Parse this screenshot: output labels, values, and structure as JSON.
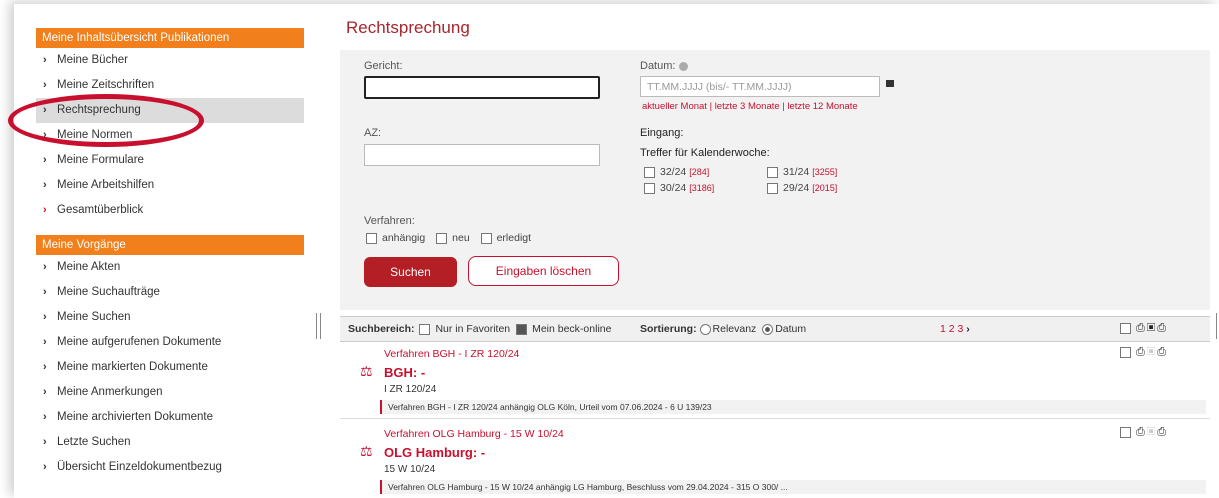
{
  "sidebar": {
    "section1_title": "Meine Inhaltsübersicht Publikationen",
    "section1_items": [
      {
        "label": "Meine Bücher"
      },
      {
        "label": "Meine Zeitschriften"
      },
      {
        "label": "Rechtsprechung"
      },
      {
        "label": "Meine Normen"
      },
      {
        "label": "Meine Formulare"
      },
      {
        "label": "Meine Arbeitshilfen"
      },
      {
        "label": "Gesamtüberblick"
      }
    ],
    "section2_title": "Meine Vorgänge",
    "section2_items": [
      {
        "label": "Meine Akten"
      },
      {
        "label": "Meine Suchaufträge"
      },
      {
        "label": "Meine Suchen"
      },
      {
        "label": "Meine aufgerufenen Dokumente"
      },
      {
        "label": "Meine markierten Dokumente"
      },
      {
        "label": "Meine Anmerkungen"
      },
      {
        "label": "Meine archivierten Dokumente"
      },
      {
        "label": "Letzte Suchen"
      },
      {
        "label": "Übersicht Einzeldokumentbezug"
      }
    ]
  },
  "page": {
    "title": "Rechtsprechung"
  },
  "form": {
    "gericht_label": "Gericht:",
    "gericht_value": "",
    "az_label": "AZ:",
    "az_value": "",
    "datum_label": "Datum:",
    "datum_placeholder": "TT.MM.JJJJ (bis/- TT.MM.JJJJ)",
    "date_links": "aktueller Monat | letzte 3 Monate | letzte 12 Monate",
    "eingang_label": "Eingang:",
    "treffer_label": "Treffer für Kalenderwoche:",
    "weeks": [
      {
        "label": "32/24",
        "count": "[284]"
      },
      {
        "label": "31/24",
        "count": "[3255]"
      },
      {
        "label": "30/24",
        "count": "[3186]"
      },
      {
        "label": "29/24",
        "count": "[2015]"
      }
    ],
    "verfahren_label": "Verfahren:",
    "verfahren_options": [
      "anhängig",
      "neu",
      "erledigt"
    ],
    "search_button": "Suchen",
    "clear_button": "Eingaben löschen"
  },
  "results_bar": {
    "suchbereich_label": "Suchbereich:",
    "opt_favoriten": "Nur in Favoriten",
    "opt_beck": "Mein beck-online",
    "sortierung_label": "Sortierung:",
    "sort_relevanz": "Relevanz",
    "sort_datum": "Datum",
    "pages": "1 2 3",
    "next": "›"
  },
  "results": [
    {
      "meta": "Verfahren BGH - I ZR 120/24",
      "title": "BGH: -",
      "az": "I ZR 120/24",
      "info": "Verfahren BGH - I ZR 120/24 anhängig OLG Köln, Urteil vom 07.06.2024 - 6 U 139/23"
    },
    {
      "meta": "Verfahren OLG Hamburg - 15 W 10/24",
      "title": "OLG Hamburg: -",
      "az": "15 W 10/24",
      "info": "Verfahren OLG Hamburg - 15 W 10/24 anhängig LG Hamburg, Beschluss vom 29.04.2024 - 315 O 300/ ..."
    }
  ],
  "colors": {
    "accent": "#f07f1c",
    "brand_red": "#c8102e"
  }
}
